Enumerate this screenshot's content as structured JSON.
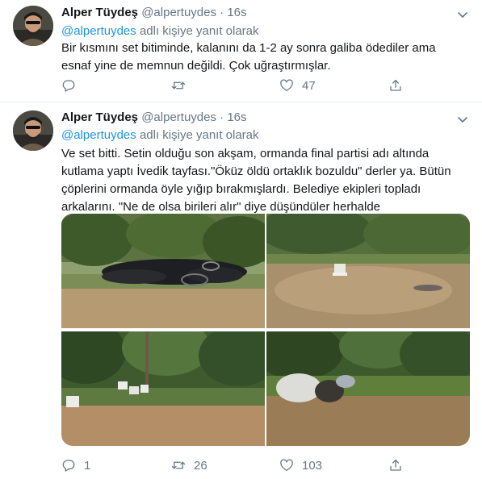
{
  "tweets": [
    {
      "name": "Alper Tüydeş",
      "handle": "@alpertuydes",
      "separator": "·",
      "time": "16s",
      "reply_to_handle": "@alpertuydes",
      "reply_suffix": "adlı kişiye yanıt olarak",
      "text_lines": [
        "Bir kısmını set bitiminde, kalanını da 1-2 ay sonra galiba ödediler ama",
        "esnaf yine de memnun değildi. Çok uğraştırmışlar."
      ],
      "replies": "",
      "retweets": "",
      "likes": "47"
    },
    {
      "name": "Alper Tüydeş",
      "handle": "@alpertuydes",
      "separator": "·",
      "time": "16s",
      "reply_to_handle": "@alpertuydes",
      "reply_suffix": "adlı kişiye yanıt olarak",
      "text_lines": [
        "Ve set bitti. Setin olduğu son akşam, ormanda final partisi adı altında",
        "kutlama yaptı İvedik tayfası.\"Öküz öldü ortaklık bozuldu\" derler ya. Bütün",
        "çöplerini ormanda öyle yığıp bırakmışlardı. Belediye ekipleri topladı",
        "arkalarını. \"Ne de olsa birileri alır\" diye düşündüler herhalde"
      ],
      "replies": "1",
      "retweets": "26",
      "likes": "103"
    }
  ],
  "icons": {
    "reply": "reply-icon",
    "retweet": "retweet-icon",
    "like": "heart-icon",
    "share": "share-icon",
    "menu": "chevron-down-icon"
  },
  "colors": {
    "text": "#14171a",
    "muted": "#657786",
    "link": "#1b95e0",
    "divider": "#e6ecf0"
  }
}
